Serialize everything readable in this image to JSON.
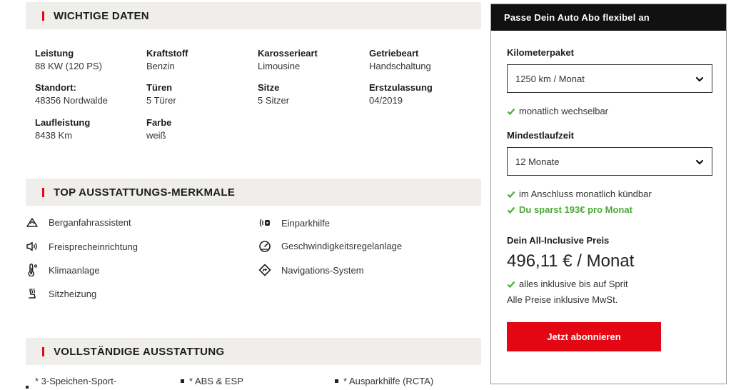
{
  "sections": {
    "important": "WICHTIGE DATEN",
    "top_features": "TOP AUSSTATTUNGS-MERKMALE",
    "full_equipment": "VOLLSTÄNDIGE AUSSTATTUNG"
  },
  "vehicle_data": [
    {
      "label": "Leistung",
      "value": "88 KW (120 PS)"
    },
    {
      "label": "Kraftstoff",
      "value": "Benzin"
    },
    {
      "label": "Karosserieart",
      "value": "Limousine"
    },
    {
      "label": "Getriebeart",
      "value": "Handschaltung"
    },
    {
      "label": "Standort:",
      "value": "48356 Nordwalde"
    },
    {
      "label": "Türen",
      "value": "5 Türer"
    },
    {
      "label": "Sitze",
      "value": "5 Sitzer"
    },
    {
      "label": "Erstzulassung",
      "value": "04/2019"
    },
    {
      "label": "Laufleistung",
      "value": "8438 Km"
    },
    {
      "label": "Farbe",
      "value": "weiß"
    }
  ],
  "features": [
    {
      "label": "Berganfahrassistent",
      "icon": "mountain-icon"
    },
    {
      "label": "Einparkhilfe",
      "icon": "parking-sensor-icon"
    },
    {
      "label": "Freisprecheinrichtung",
      "icon": "speaker-icon"
    },
    {
      "label": "Geschwindigkeitsregelanlage",
      "icon": "speedometer-icon"
    },
    {
      "label": "Klimaanlage",
      "icon": "thermometer-icon"
    },
    {
      "label": "Navigations-System",
      "icon": "navigation-icon"
    },
    {
      "label": "Sitzheizung",
      "icon": "seat-heating-icon"
    }
  ],
  "equipment": [
    "* 3-Speichen-Sport-",
    "* ABS & ESP",
    "* Ausparkhilfe (RCTA)"
  ],
  "panel": {
    "header": "Passe Dein Auto Abo flexibel an",
    "km_label": "Kilometerpaket",
    "km_value": "1250 km / Monat",
    "km_note": "monatlich wechselbar",
    "term_label": "Mindestlaufzeit",
    "term_value": "12 Monate",
    "term_note": "im Anschluss monatlich kündbar",
    "savings": "Du sparst 193€ pro Monat",
    "price_label": "Dein All-Inclusive Preis",
    "price": "496,11 € / Monat",
    "incl_note": "alles inklusive bis auf Sprit",
    "tax_note": "Alle Preise inklusive MwSt.",
    "cta": "Jetzt abonnieren"
  },
  "colors": {
    "accent": "#e30613",
    "success": "#4caa3a",
    "header_bg": "#111111",
    "section_bg": "#efeeea"
  }
}
